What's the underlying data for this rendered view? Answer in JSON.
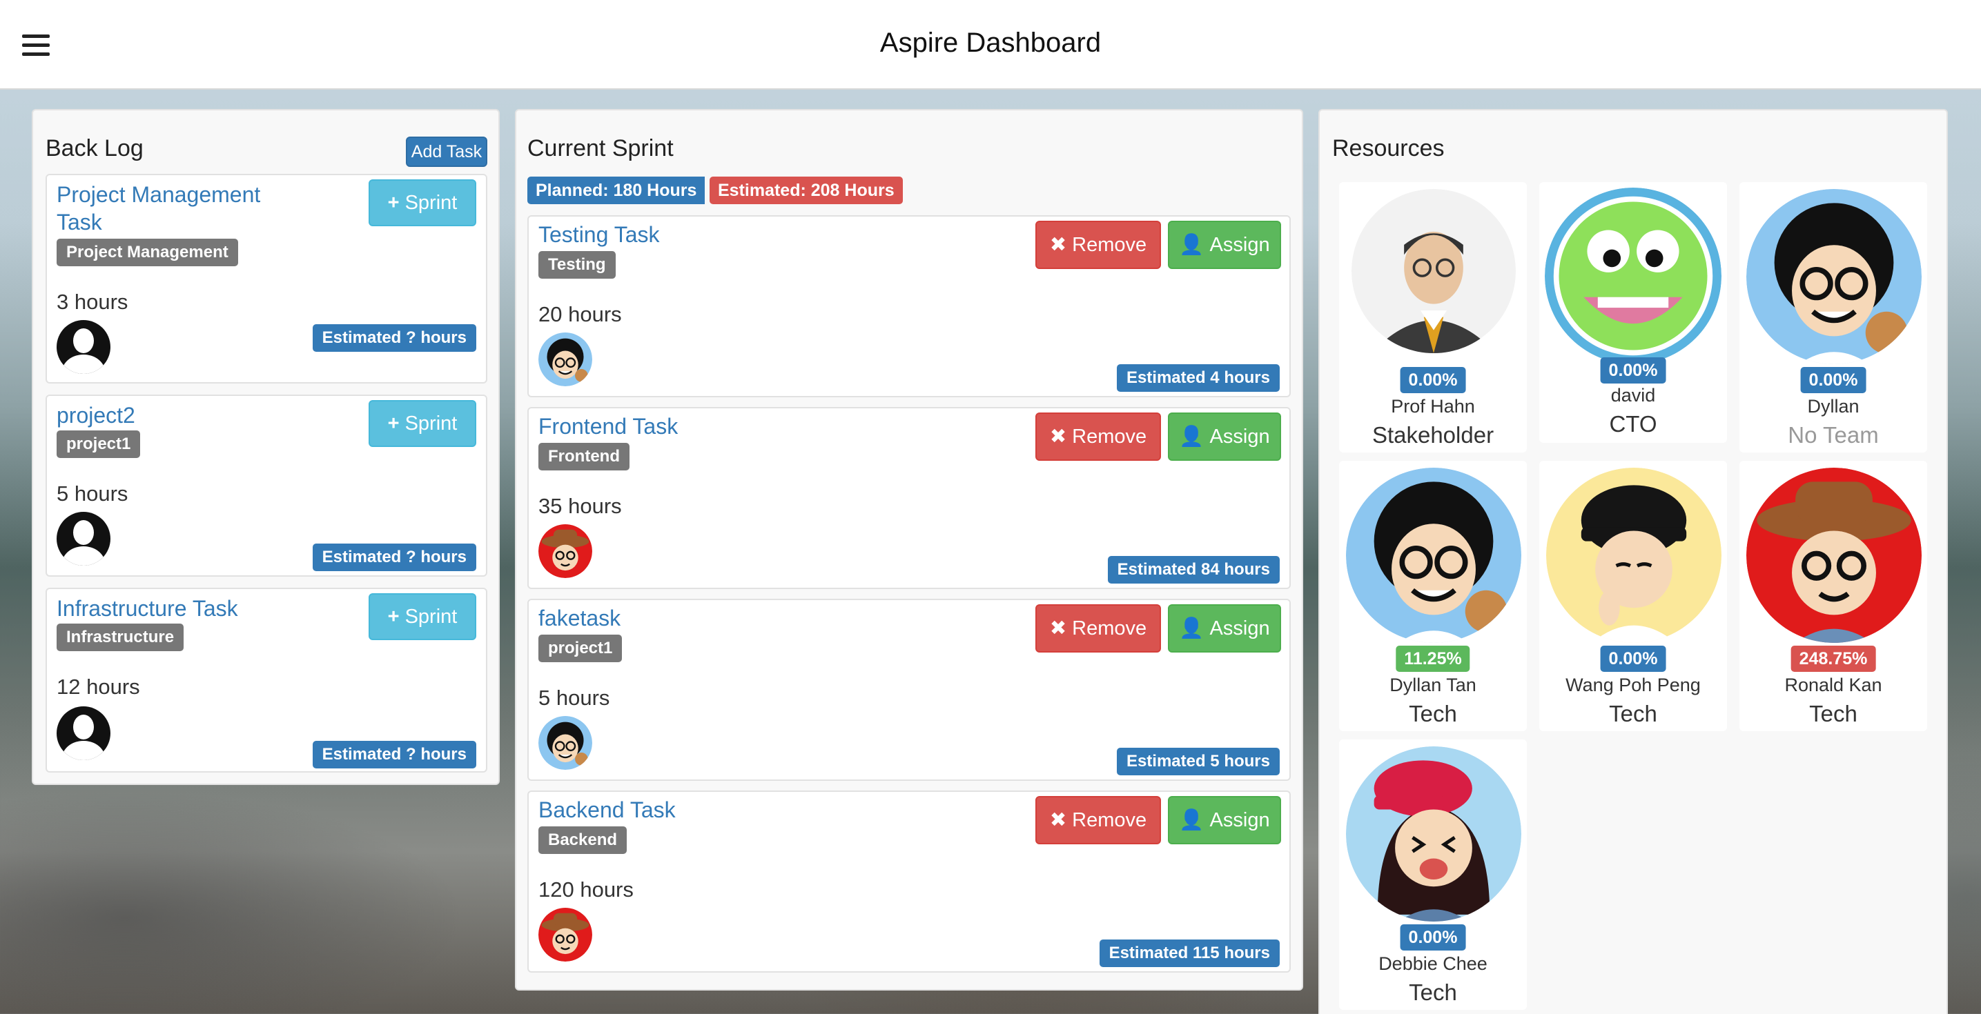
{
  "header": {
    "title": "Aspire Dashboard"
  },
  "backlog": {
    "title": "Back Log",
    "add_task_label": "Add Task",
    "sprint_button_label": "Sprint",
    "tasks": [
      {
        "name": "Project Management Task",
        "tag": "Project Management",
        "hours": "3 hours",
        "estimate": "Estimated ? hours"
      },
      {
        "name": "project2",
        "tag": "project1",
        "hours": "5 hours",
        "estimate": "Estimated ? hours"
      },
      {
        "name": "Infrastructure Task",
        "tag": "Infrastructure",
        "hours": "12 hours",
        "estimate": "Estimated ? hours"
      }
    ]
  },
  "sprint": {
    "title": "Current Sprint",
    "planned": "Planned: 180 Hours",
    "estimated": "Estimated: 208 Hours",
    "remove_label": "Remove",
    "assign_label": "Assign",
    "tasks": [
      {
        "name": "Testing Task",
        "tag": "Testing",
        "hours": "20 hours",
        "estimate": "Estimated 4 hours",
        "assignee_avatar": "curly-hair-boy"
      },
      {
        "name": "Frontend Task",
        "tag": "Frontend",
        "hours": "35 hours",
        "estimate": "Estimated 84 hours",
        "assignee_avatar": "cowboy-boy"
      },
      {
        "name": "faketask",
        "tag": "project1",
        "hours": "5 hours",
        "estimate": "Estimated 5 hours",
        "assignee_avatar": "curly-hair-boy"
      },
      {
        "name": "Backend Task",
        "tag": "Backend",
        "hours": "120 hours",
        "estimate": "Estimated 115 hours",
        "assignee_avatar": "cowboy-boy"
      }
    ]
  },
  "resources": {
    "title": "Resources",
    "people": [
      {
        "name": "Prof Hahn",
        "team": "Stakeholder",
        "pct": "0.00%",
        "pct_color": "#337ab7",
        "avatar": "man-in-suit"
      },
      {
        "name": "david",
        "team": "CTO",
        "pct": "0.00%",
        "pct_color": "#337ab7",
        "avatar": "green-monster"
      },
      {
        "name": "Dyllan",
        "team": "No Team",
        "pct": "0.00%",
        "pct_color": "#337ab7",
        "avatar": "curly-hair-boy"
      },
      {
        "name": "Dyllan Tan",
        "team": "Tech",
        "pct": "11.25%",
        "pct_color": "#5cb85c",
        "avatar": "curly-hair-boy"
      },
      {
        "name": "Wang Poh Peng",
        "team": "Tech",
        "pct": "0.00%",
        "pct_color": "#337ab7",
        "avatar": "cap-boy"
      },
      {
        "name": "Ronald Kan",
        "team": "Tech",
        "pct": "248.75%",
        "pct_color": "#d9534f",
        "avatar": "cowboy-boy"
      },
      {
        "name": "Debbie Chee",
        "team": "Tech",
        "pct": "0.00%",
        "pct_color": "#337ab7",
        "avatar": "red-cap-girl"
      }
    ]
  },
  "colors": {
    "primary": "#337ab7",
    "info": "#5bc0de",
    "danger": "#d9534f",
    "success": "#5cb85c",
    "tag_gray": "#777777"
  }
}
